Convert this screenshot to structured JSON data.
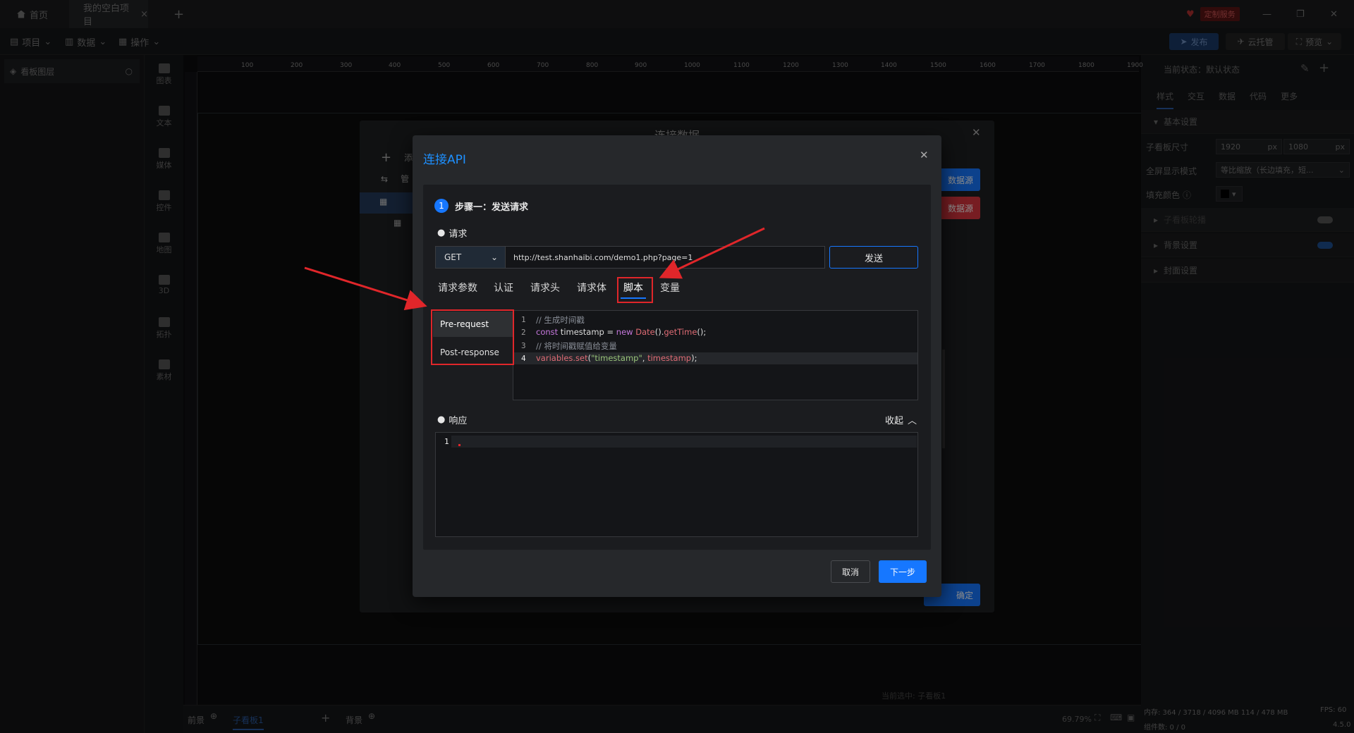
{
  "titlebar": {
    "home_tab": "首页",
    "project_tab": "我的空白项目",
    "custom_service": "定制服务"
  },
  "menubar": {
    "items": [
      "项目",
      "数据",
      "操作"
    ],
    "publish": "发布",
    "cloud_host": "云托管",
    "preview": "预览"
  },
  "layers": {
    "title": "看板图层"
  },
  "toolbox": {
    "items": [
      "图表",
      "文本",
      "媒体",
      "控件",
      "地图",
      "3D",
      "拓扑",
      "素材"
    ]
  },
  "ruler": {
    "ticks": [
      "100",
      "200",
      "300",
      "400",
      "500",
      "600",
      "700",
      "800",
      "900",
      "1000",
      "1100",
      "1200",
      "1300",
      "1400",
      "1500",
      "1600",
      "1700",
      "1800",
      "1900"
    ]
  },
  "right_panel": {
    "current_state": "当前状态：默认状态",
    "tabs": [
      "样式",
      "交互",
      "数据",
      "代码",
      "更多"
    ],
    "basic_settings": "基本设置",
    "board_size_label": "子看板尺寸",
    "width": "1920",
    "height": "1080",
    "unit": "px",
    "fullscreen_label": "全屏显示模式",
    "fullscreen_value": "等比缩放（长边填充，短...",
    "fill_color_label": "填充颜色",
    "carousel": "子看板轮播",
    "background_settings": "背景设置",
    "cover_settings": "封面设置"
  },
  "bottombar": {
    "front": "前景",
    "board_tab": "子看板1",
    "back": "背景",
    "selected": "当前选中: 子看板1",
    "zoom": "69.79%",
    "memory": "内存: 364 / 3718 / 4096 MB  114 / 478 MB",
    "fps": "FPS: 60",
    "component_count": "组件数: 0 / 0",
    "version": "4.5.0"
  },
  "outer_dialog": {
    "title": "连接数据",
    "side_items": [
      "添",
      "管"
    ],
    "btn_blue": "数据源",
    "btn_red": "数据源",
    "ok": "确定"
  },
  "api_dialog": {
    "title": "连接API",
    "step_num": "1",
    "step_title": "步骤一：发送请求",
    "request_label": "请求",
    "method": "GET",
    "url": "http://test.shanhaibi.com/demo1.php?page=1",
    "send": "发送",
    "tabs": [
      "请求参数",
      "认证",
      "请求头",
      "请求体",
      "脚本",
      "变量"
    ],
    "active_tab": "脚本",
    "script_tabs": [
      "Pre-request",
      "Post-response"
    ],
    "code_lines": [
      "1",
      "2",
      "3",
      "4"
    ],
    "code": {
      "l1": "// 生成时间戳",
      "l2_kw": "const",
      "l2_var": " timestamp = ",
      "l2_new": "new",
      "l2_fn": " Date",
      "l2_p1": "().",
      "l2_fn2": "getTime",
      "l2_p2": "();",
      "l3": "// 将时间戳赋值给变量",
      "l4_fn": "variables.set",
      "l4_p1": "(",
      "l4_str": "\"timestamp\"",
      "l4_p2": ", ",
      "l4_var": "timestamp",
      "l4_p3": ");"
    },
    "response_label": "响应",
    "collapse": "收起",
    "response_line": "1",
    "cancel": "取消",
    "next": "下一步"
  },
  "colors": {
    "accent": "#1677ff",
    "highlight": "#e0262a"
  }
}
